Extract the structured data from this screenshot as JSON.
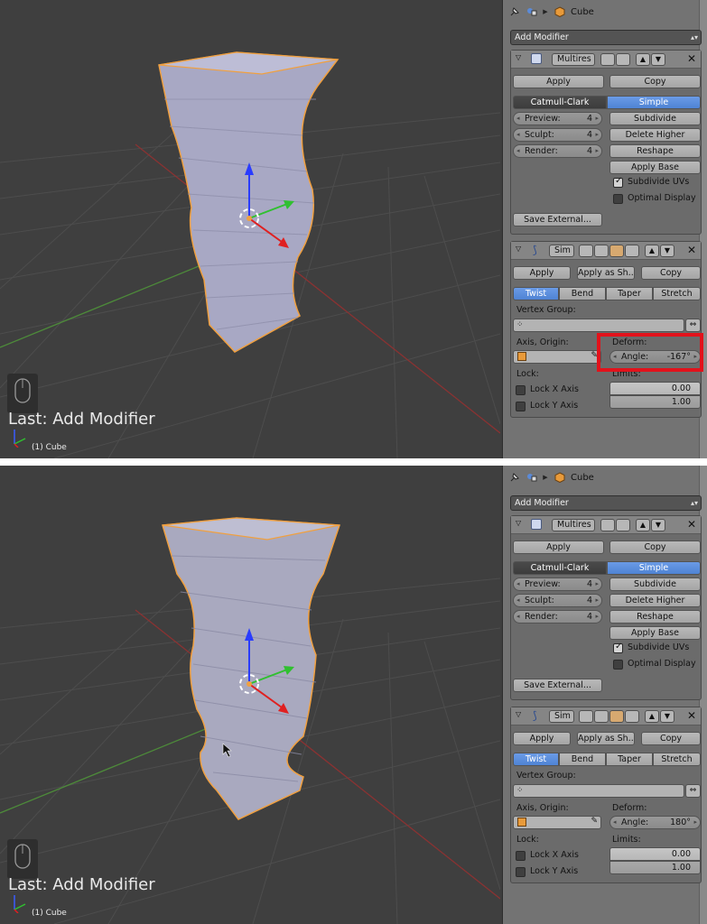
{
  "screenshots": [
    {
      "id": "top",
      "viewport": {
        "last_operator": "Last: Add Modifier",
        "object_label": "(1) Cube"
      },
      "header": {
        "object_name": "Cube"
      },
      "add_modifier": "Add Modifier",
      "multires": {
        "name": "Multires",
        "apply": "Apply",
        "copy": "Copy",
        "tab_catmull": "Catmull-Clark",
        "tab_simple": "Simple",
        "preview_label": "Preview:",
        "preview_value": "4",
        "sculpt_label": "Sculpt:",
        "sculpt_value": "4",
        "render_label": "Render:",
        "render_value": "4",
        "subdivide": "Subdivide",
        "delete_higher": "Delete Higher",
        "reshape": "Reshape",
        "apply_base": "Apply Base",
        "subdivide_uvs": "Subdivide UVs",
        "optimal_display": "Optimal Display",
        "save_external": "Save External..."
      },
      "simple_deform": {
        "name": "Sim",
        "apply": "Apply",
        "apply_as_shape": "Apply as Sh...",
        "copy": "Copy",
        "tab_twist": "Twist",
        "tab_bend": "Bend",
        "tab_taper": "Taper",
        "tab_stretch": "Stretch",
        "vertex_group_label": "Vertex Group:",
        "axis_origin_label": "Axis, Origin:",
        "deform_label": "Deform:",
        "angle_label": "Angle:",
        "angle_value": "-167°",
        "lock_label": "Lock:",
        "limits_label": "Limits:",
        "lock_x": "Lock X Axis",
        "lock_y": "Lock Y Axis",
        "limit_min": "0.00",
        "limit_max": "1.00"
      }
    },
    {
      "id": "bottom",
      "viewport": {
        "last_operator": "Last: Add Modifier",
        "object_label": "(1) Cube"
      },
      "header": {
        "object_name": "Cube"
      },
      "add_modifier": "Add Modifier",
      "multires": {
        "name": "Multires",
        "apply": "Apply",
        "copy": "Copy",
        "tab_catmull": "Catmull-Clark",
        "tab_simple": "Simple",
        "preview_label": "Preview:",
        "preview_value": "4",
        "sculpt_label": "Sculpt:",
        "sculpt_value": "4",
        "render_label": "Render:",
        "render_value": "4",
        "subdivide": "Subdivide",
        "delete_higher": "Delete Higher",
        "reshape": "Reshape",
        "apply_base": "Apply Base",
        "subdivide_uvs": "Subdivide UVs",
        "optimal_display": "Optimal Display",
        "save_external": "Save External..."
      },
      "simple_deform": {
        "name": "Sim",
        "apply": "Apply",
        "apply_as_shape": "Apply as Sh...",
        "copy": "Copy",
        "tab_twist": "Twist",
        "tab_bend": "Bend",
        "tab_taper": "Taper",
        "tab_stretch": "Stretch",
        "vertex_group_label": "Vertex Group:",
        "axis_origin_label": "Axis, Origin:",
        "deform_label": "Deform:",
        "angle_label": "Angle:",
        "angle_value": "180°",
        "lock_label": "Lock:",
        "limits_label": "Limits:",
        "lock_x": "Lock X Axis",
        "lock_y": "Lock Y Axis",
        "limit_min": "0.00",
        "limit_max": "1.00"
      }
    }
  ],
  "colors": {
    "highlight": "#e2121b",
    "selected_tab": "#5a8fdc",
    "panel_bg": "#737373",
    "viewport_bg": "#3f3f3f",
    "mesh_outline": "#f0a040"
  }
}
